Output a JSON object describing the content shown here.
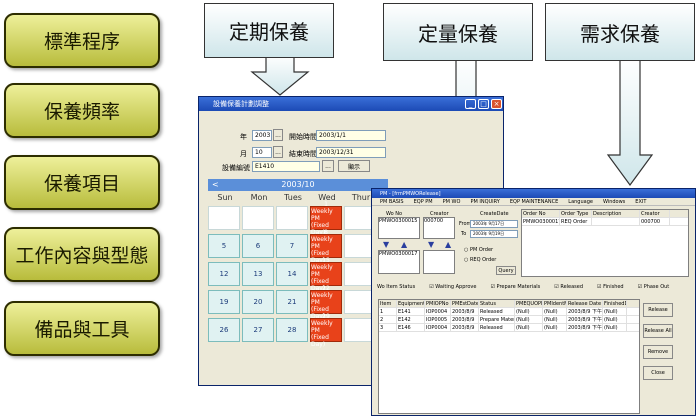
{
  "menu": [
    "標準程序",
    "保養頻率",
    "保養項目",
    "工作內容與型態",
    "備品與工具"
  ],
  "callouts": {
    "periodic": "定期保養",
    "quantity": "定量保養",
    "demand": "需求保養"
  },
  "sched_window": {
    "title": "設備保養計劃調整",
    "year_label": "年",
    "year": "2003",
    "month_label": "月",
    "month": "10",
    "start_label": "開始時間",
    "start": "2003/1/1",
    "end_label": "結束時間",
    "end": "2003/12/31",
    "equip_label": "設備編號",
    "equip": "E1410",
    "browse": "...",
    "show_btn": "顯示",
    "cal_title": "2003/10",
    "prev": "<",
    "next": ">",
    "days": [
      "Sun",
      "Mon",
      "Tues",
      "Wed",
      "Thur"
    ],
    "weeks": [
      [
        "",
        "",
        "",
        "1",
        ""
      ],
      [
        "5",
        "6",
        "7",
        "8",
        ""
      ],
      [
        "12",
        "13",
        "14",
        "15",
        ""
      ],
      [
        "19",
        "20",
        "21",
        "22",
        ""
      ],
      [
        "26",
        "27",
        "28",
        "29",
        ""
      ]
    ],
    "pm_label": [
      "Weekly PM",
      "(Fixed Day)"
    ]
  },
  "pm_window": {
    "title": "PM - [frmPMWORelease]",
    "menubar": [
      "PM BASIS",
      "EQP PM",
      "PM WO",
      "PM INQUIRY",
      "EQP MAINTENANCE",
      "Language",
      "Windows",
      "EXIT"
    ],
    "wo_no_label": "Wo No",
    "creator_label": "Creator",
    "createdate_label": "CreateDate",
    "wo_list": [
      "PMWO0300015",
      "PMWO0300017"
    ],
    "creator_val": "000700",
    "from_label": "From",
    "to_label": "To",
    "from_date": "2003年 9月17日",
    "to_date": "2003年 9月19日",
    "radio_pm": "PM Order",
    "radio_req": "REQ Order",
    "query_btn": "Query",
    "order_cols": [
      "Order No",
      "Order Type",
      "Description",
      "Creator"
    ],
    "order_rows": [
      [
        "PMWO0300017",
        "REQ Order",
        "",
        "000700"
      ]
    ],
    "status_label": "Wo Item Status",
    "status_opts": [
      "Waiting Approve",
      "Prepare Materials",
      "Released",
      "Finished",
      "Phase Out"
    ],
    "item_cols": [
      "Item",
      "EquipmentNo",
      "PMIOPNo",
      "PMEstDateTim",
      "Status",
      "PMEQUOPN",
      "PMIdentM",
      "Release Date",
      "FinishedDa"
    ],
    "item_rows": [
      [
        "1",
        "E141",
        "IOP0004",
        "2003/8/9",
        "Released",
        "(Null)",
        "(Null)",
        "2003/8/9 下午",
        "(Null)"
      ],
      [
        "2",
        "E142",
        "IOP0005",
        "2003/8/9",
        "Prepare Materials",
        "(Null)",
        "(Null)",
        "2003/8/9 下午",
        "(Null)"
      ],
      [
        "3",
        "E146",
        "IOP0004",
        "2003/8/9",
        "Released",
        "(Null)",
        "(Null)",
        "2003/8/9 下午",
        "(Null)"
      ]
    ],
    "buttons": [
      "Release",
      "Release All",
      "Remove",
      "Close"
    ]
  }
}
